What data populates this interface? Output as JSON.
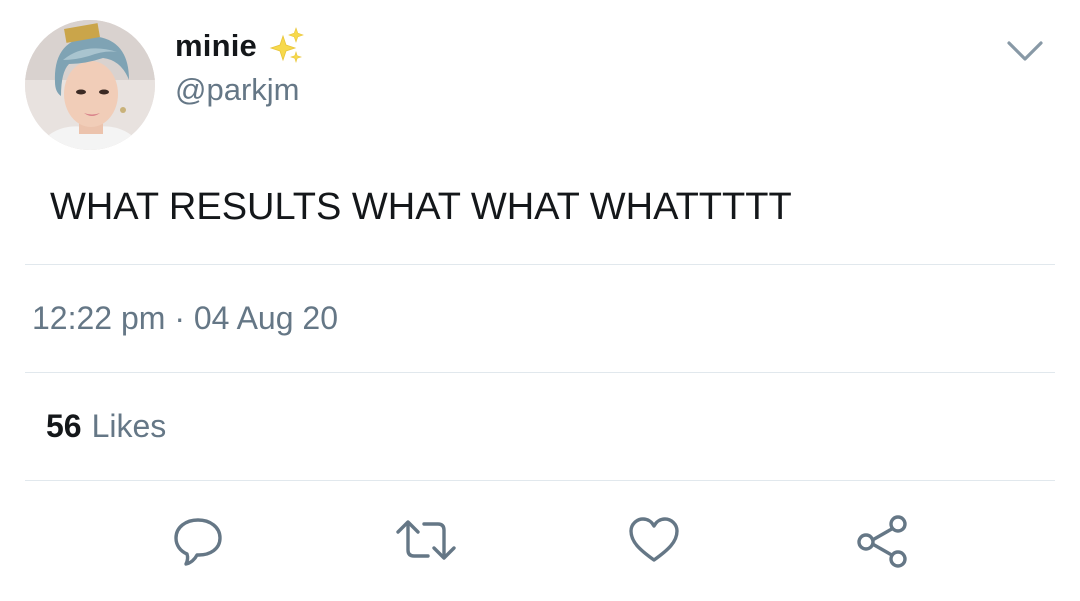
{
  "user": {
    "display_name": "minie",
    "handle": "@parkjm",
    "name_emoji": "sparkles-icon"
  },
  "tweet": {
    "text": "WHAT RESULTS WHAT WHAT WHATTTTT",
    "timestamp": "12:22 pm · 04 Aug 20",
    "likes_count": "56",
    "likes_label": "Likes"
  },
  "actions": [
    {
      "name": "reply",
      "icon": "comment-icon"
    },
    {
      "name": "retweet",
      "icon": "retweet-icon"
    },
    {
      "name": "like",
      "icon": "heart-icon"
    },
    {
      "name": "share",
      "icon": "share-icon"
    }
  ],
  "colors": {
    "primary_text": "#14171a",
    "secondary_text": "#657786",
    "divider": "#e1e8ed",
    "icon_gray": "#657786",
    "sparkle": "#f7d94c"
  }
}
